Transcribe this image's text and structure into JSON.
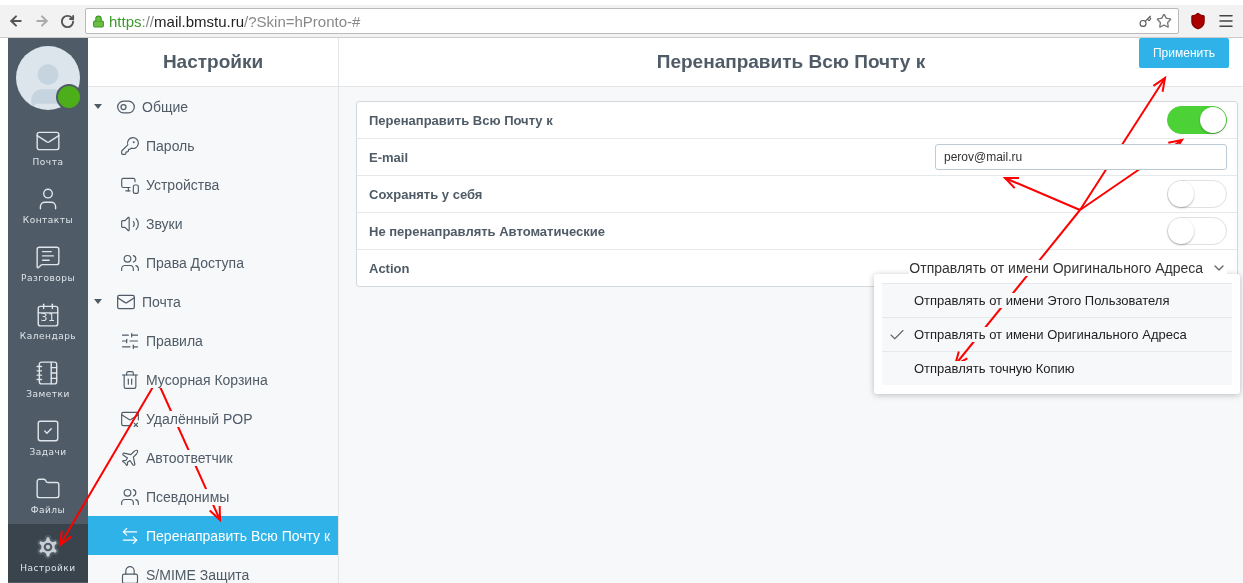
{
  "browser": {
    "url_scheme": "https",
    "url_sep": "://",
    "url_host": "mail.bmstu.ru",
    "url_path": "/?Skin=hPronto-#"
  },
  "rail": [
    {
      "label": "Почта",
      "selected": false
    },
    {
      "label": "Контакты",
      "selected": false
    },
    {
      "label": "Разговоры",
      "selected": false
    },
    {
      "label": "Календарь",
      "icon_text": "31",
      "selected": false
    },
    {
      "label": "Заметки",
      "selected": false
    },
    {
      "label": "Задачи",
      "selected": false
    },
    {
      "label": "Файлы",
      "selected": false
    },
    {
      "label": "Настройки",
      "selected": true
    }
  ],
  "settings_title": "Настройки",
  "tree": [
    {
      "label": "Общие",
      "expanded": true,
      "children": [
        {
          "label": "Пароль",
          "selected": false
        },
        {
          "label": "Устройства",
          "selected": false
        },
        {
          "label": "Звуки",
          "selected": false
        },
        {
          "label": "Права Доступа",
          "selected": false
        }
      ]
    },
    {
      "label": "Почта",
      "expanded": true,
      "children": [
        {
          "label": "Правила",
          "selected": false
        },
        {
          "label": "Мусорная Корзина",
          "selected": false
        },
        {
          "label": "Удалённый POP",
          "selected": false
        },
        {
          "label": "Автоответчик",
          "selected": false
        },
        {
          "label": "Псевдонимы",
          "selected": false
        },
        {
          "label": "Перенаправить Всю Почту к",
          "selected": true
        },
        {
          "label": "S/MIME Защита",
          "selected": false
        }
      ]
    }
  ],
  "page_title": "Перенаправить Всю Почту к",
  "apply_button": "Применить",
  "rows": [
    {
      "kind": "toggle",
      "label": "Перенаправить Всю Почту к",
      "on": true
    },
    {
      "kind": "input",
      "label": "E-mail",
      "value": "perov@mail.ru"
    },
    {
      "kind": "toggle",
      "label": "Сохранять у себя",
      "on": false
    },
    {
      "kind": "toggle",
      "label": "Не перенаправлять Автоматические",
      "on": false
    },
    {
      "kind": "select",
      "label": "Action",
      "value": "Отправлять от имени Оригинального Адреса"
    }
  ],
  "dropdown": {
    "open": true,
    "options": [
      {
        "label": "Отправлять от имени Этого Пользователя",
        "selected": false
      },
      {
        "label": "Отправлять от имени Оригинального Адреса",
        "selected": true
      },
      {
        "label": "Отправлять точную Копию",
        "selected": false
      }
    ]
  }
}
